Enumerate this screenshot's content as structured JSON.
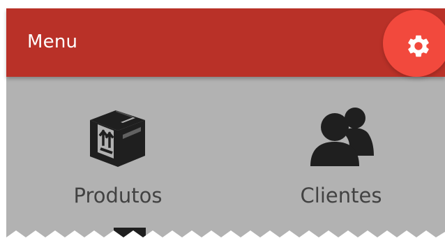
{
  "app_bar": {
    "title": "Menu"
  },
  "actions": {
    "settings_icon": "gear-icon"
  },
  "menu": {
    "items": [
      {
        "label": "Produtos",
        "icon": "package-box-icon"
      },
      {
        "label": "Clientes",
        "icon": "users-icon"
      }
    ]
  },
  "colors": {
    "app_bar": "#b93128",
    "fab": "#f2493d",
    "content_background": "#b2b2b2",
    "icon": "#1f1f1f",
    "label": "#424242",
    "white": "#ffffff"
  }
}
